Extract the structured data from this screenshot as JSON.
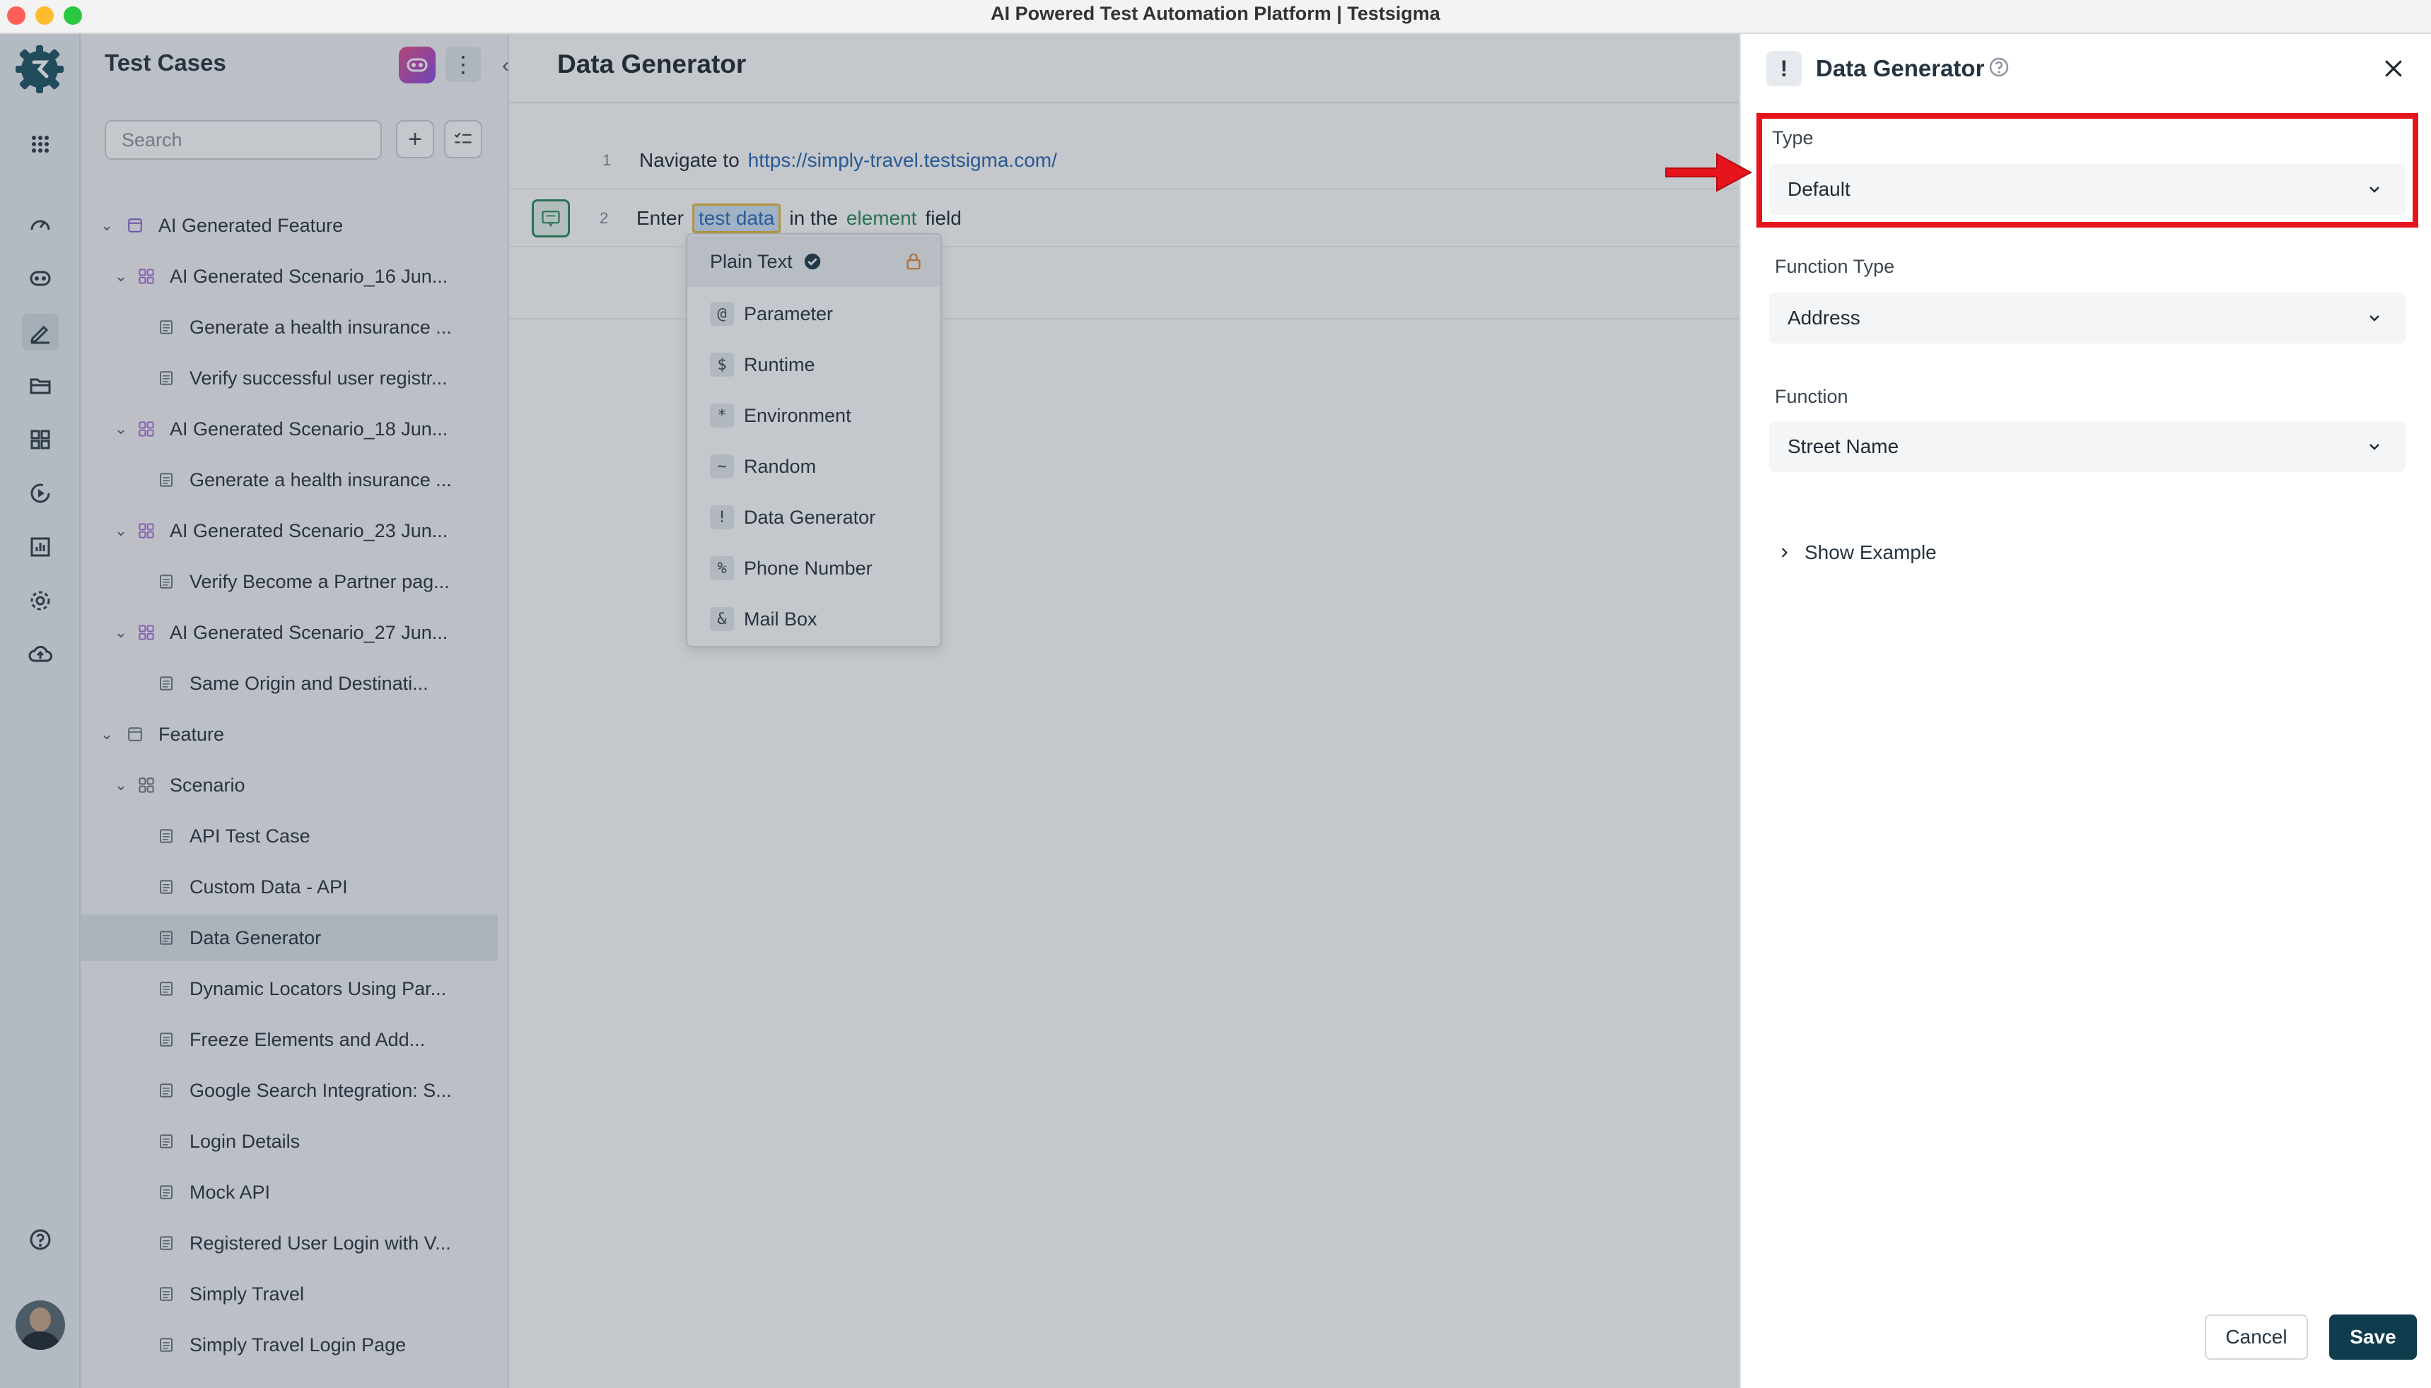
{
  "window": {
    "title": "AI Powered Test Automation Platform | Testsigma"
  },
  "rail": {
    "icons": [
      "apps-grid-icon",
      "dashboard-icon",
      "copilot-icon",
      "test-cases-icon",
      "folder-icon",
      "modules-icon",
      "run-icon",
      "reports-icon",
      "settings-icon",
      "cloud-upload-icon",
      "help-icon",
      "avatar"
    ]
  },
  "tree": {
    "title": "Test Cases",
    "search_placeholder": "Search",
    "add_label": "+",
    "items": [
      {
        "label": "AI Generated Feature",
        "type": "feature"
      },
      {
        "label": "AI Generated Scenario_16 Jun...",
        "type": "scenario"
      },
      {
        "label": "Generate a health insurance ...",
        "type": "case"
      },
      {
        "label": "Verify successful user registr...",
        "type": "case"
      },
      {
        "label": "AI Generated Scenario_18 Jun...",
        "type": "scenario"
      },
      {
        "label": "Generate a health insurance ...",
        "type": "case"
      },
      {
        "label": "AI Generated Scenario_23 Jun...",
        "type": "scenario"
      },
      {
        "label": "Verify Become a Partner pag...",
        "type": "case"
      },
      {
        "label": "AI Generated Scenario_27 Jun...",
        "type": "scenario"
      },
      {
        "label": "Same Origin and Destinati...",
        "type": "case"
      },
      {
        "label": "Feature",
        "type": "feature"
      },
      {
        "label": "Scenario",
        "type": "scenario"
      },
      {
        "label": "API Test Case",
        "type": "case"
      },
      {
        "label": "Custom Data - API",
        "type": "case"
      },
      {
        "label": "Data Generator",
        "type": "case",
        "selected": true
      },
      {
        "label": "Dynamic Locators Using Par...",
        "type": "case"
      },
      {
        "label": "Freeze Elements and Add...",
        "type": "case"
      },
      {
        "label": "Google Search Integration: S...",
        "type": "case"
      },
      {
        "label": "Login Details",
        "type": "case"
      },
      {
        "label": "Mock API",
        "type": "case"
      },
      {
        "label": "Registered User Login with V...",
        "type": "case"
      },
      {
        "label": "Simply Travel",
        "type": "case"
      },
      {
        "label": "Simply Travel Login Page",
        "type": "case"
      }
    ]
  },
  "editor": {
    "title": "Data Generator",
    "steps": [
      {
        "num": "1",
        "prefix": "Navigate to",
        "link": "https://simply-travel.testsigma.com/"
      },
      {
        "num": "2",
        "prefix": "Enter",
        "chip": "test data",
        "middle": "in the",
        "element": "element",
        "suffix": "field"
      }
    ],
    "dropdown": [
      {
        "sym": "",
        "label": "Plain Text"
      },
      {
        "sym": "@",
        "label": "Parameter"
      },
      {
        "sym": "$",
        "label": "Runtime"
      },
      {
        "sym": "*",
        "label": "Environment"
      },
      {
        "sym": "~",
        "label": "Random"
      },
      {
        "sym": "!",
        "label": "Data Generator"
      },
      {
        "sym": "%",
        "label": "Phone Number"
      },
      {
        "sym": "&",
        "label": "Mail Box"
      }
    ]
  },
  "drawer": {
    "icon": "!",
    "title": "Data Generator",
    "type_label": "Type",
    "type_value": "Default",
    "function_type_label": "Function Type",
    "function_type_value": "Address",
    "function_label": "Function",
    "function_value": "Street Name",
    "show_example": "Show Example",
    "cancel": "Cancel",
    "save": "Save"
  },
  "colors": {
    "highlight": "#e6141c",
    "save_button": "#0f3d4d",
    "link": "#2869b3",
    "brand": "#0f3d4d"
  }
}
